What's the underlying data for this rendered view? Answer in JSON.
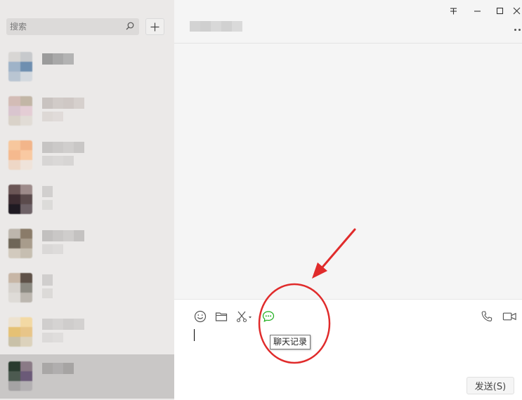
{
  "sidebar": {
    "search": {
      "placeholder": "搜索",
      "value": ""
    },
    "icons": {
      "search": "search-icon",
      "add": "plus-icon"
    },
    "conversations": [
      {
        "avatar_colors": [
          "#d8d6d4",
          "#c7c9cc",
          "#9fb3c8",
          "#6f8fb0",
          "#b9c5d2",
          "#d4d9df"
        ],
        "name_colors": [
          "#9b9b9b",
          "#a8a8a8",
          "#b3b3b3"
        ],
        "preview_colors": []
      },
      {
        "avatar_colors": [
          "#d3bcb6",
          "#c2b6a6",
          "#d9c5cf",
          "#e4cdd5",
          "#d9d2c9",
          "#e1dcd6"
        ],
        "name_colors": [
          "#c9c3c0",
          "#d1cbc8",
          "#cfc8c5",
          "#d6d0cd"
        ],
        "preview_colors": [
          "#d8d1ce",
          "#dcd6d3"
        ]
      },
      {
        "avatar_colors": [
          "#f7c79d",
          "#f2b58a",
          "#f5b98e",
          "#f9c9a2",
          "#eed7c6",
          "#efe3da"
        ],
        "name_colors": [
          "#c6c4c3",
          "#cbc9c8",
          "#d0cecd",
          "#c9c7c6"
        ],
        "preview_colors": [
          "#cfcdcc",
          "#d4d2d1",
          "#cfcdcc"
        ]
      },
      {
        "avatar_colors": [
          "#6b5656",
          "#9d8b8a",
          "#3d2c31",
          "#5b4b4c",
          "#1f1a22",
          "#6e6267"
        ],
        "name_colors": [
          "#d1cfce"
        ],
        "preview_colors": [
          "#d6d4d3"
        ]
      },
      {
        "avatar_colors": [
          "#bdb6ad",
          "#8a7b69",
          "#6f6658",
          "#a89c8c",
          "#d2cabe",
          "#c6beb1"
        ],
        "name_colors": [
          "#c2c0bf",
          "#c9c7c6",
          "#cfcdcc",
          "#c4c2c1"
        ],
        "preview_colors": [
          "#d4d2d1",
          "#d8d6d5"
        ]
      },
      {
        "avatar_colors": [
          "#c7b6a6",
          "#5e5148",
          "#d6d2cd",
          "#8c8a82",
          "#dedbd7",
          "#bcb7b0"
        ],
        "name_colors": [
          "#d0cecd"
        ],
        "preview_colors": [
          "#d5d3d2"
        ]
      },
      {
        "avatar_colors": [
          "#ede2cf",
          "#f3d9a4",
          "#e5c174",
          "#e8c589",
          "#c9c1a8",
          "#dcd2bc"
        ],
        "name_colors": [
          "#d0cecd",
          "#d5d3d2",
          "#cfcdcc",
          "#d3d1d0"
        ],
        "preview_colors": [
          "#d6d4d3",
          "#dad8d7"
        ]
      },
      {
        "avatar_colors": [
          "#2a3b2f",
          "#8a7a86",
          "#4c5a50",
          "#6b5a78",
          "#a5a3a4",
          "#b3b0b2"
        ],
        "name_colors": [
          "#a9a7a6",
          "#b0aeae",
          "#a6a4a3"
        ],
        "preview_colors": []
      }
    ],
    "selected_index": 7
  },
  "chat": {
    "title_colors": [
      "#d3d3d3",
      "#cfcfcf",
      "#d8d8d8",
      "#d1d1d1",
      "#dadada"
    ],
    "window_controls": [
      "pin-icon",
      "minimize-icon",
      "maximize-icon",
      "close-icon"
    ],
    "toolbar": [
      "emoji-icon",
      "folder-icon",
      "scissors-icon",
      "chat-history-icon",
      "phone-icon",
      "video-call-icon"
    ],
    "tooltip": "聊天记录",
    "send_label": "发送(S)",
    "accent_green": "#1aad19"
  },
  "annotation": {
    "color": "#e02b2b"
  }
}
